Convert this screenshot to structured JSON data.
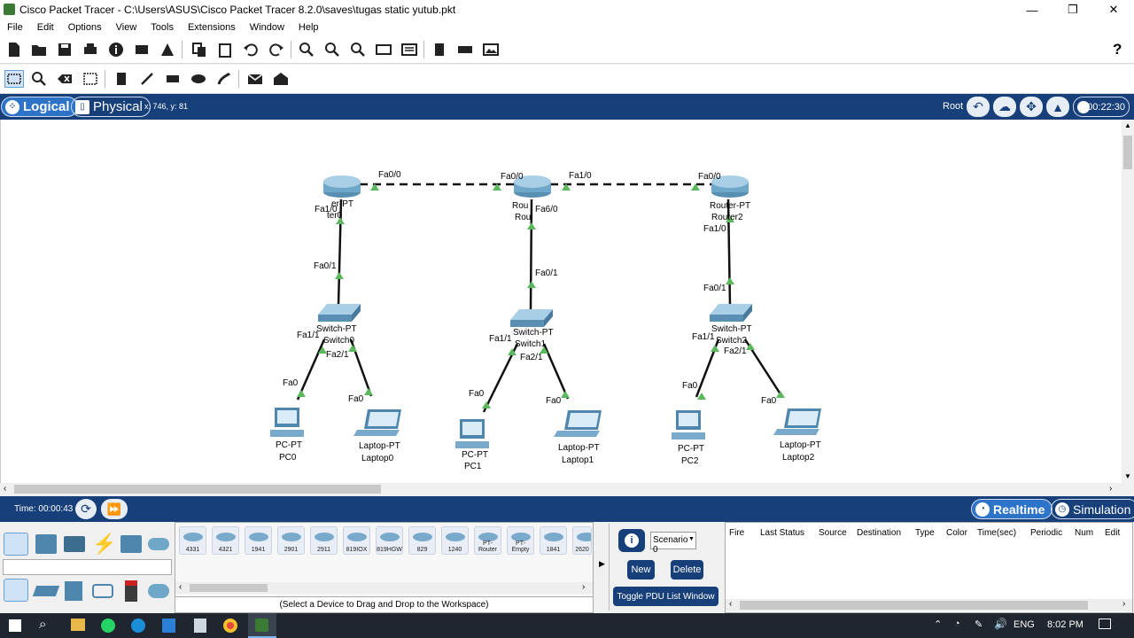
{
  "window": {
    "title": "Cisco Packet Tracer - C:\\Users\\ASUS\\Cisco Packet Tracer 8.2.0\\saves\\tugas static yutub.pkt",
    "controls": [
      "—",
      "❐",
      "✕"
    ]
  },
  "menu": [
    "File",
    "Edit",
    "Options",
    "View",
    "Tools",
    "Extensions",
    "Window",
    "Help"
  ],
  "toolbar1": {
    "help_label": "?"
  },
  "views": {
    "logical": "Logical",
    "physical": "Physical",
    "coords": "x: 746, y: 81",
    "root": "Root",
    "clock": "00:22:30"
  },
  "topology": {
    "devices": [
      {
        "name": "Router0",
        "type": "Router-PT"
      },
      {
        "name": "Router1",
        "type": "Router-PT"
      },
      {
        "name": "Router2",
        "type": "Router-PT"
      },
      {
        "name": "Switch0",
        "type": "Switch-PT"
      },
      {
        "name": "Switch1",
        "type": "Switch-PT"
      },
      {
        "name": "Switch2",
        "type": "Switch-PT"
      },
      {
        "name": "PC0",
        "type": "PC-PT"
      },
      {
        "name": "PC1",
        "type": "PC-PT"
      },
      {
        "name": "PC2",
        "type": "PC-PT"
      },
      {
        "name": "Laptop0",
        "type": "Laptop-PT"
      },
      {
        "name": "Laptop1",
        "type": "Laptop-PT"
      },
      {
        "name": "Laptop2",
        "type": "Laptop-PT"
      }
    ],
    "labels": {
      "r0_r1_a": "Fa0/0",
      "r1_r0": "Fa0/0",
      "r1_r2": "Fa1/0",
      "r2_r1": "Fa0/0",
      "r0_down": "Fa1/0",
      "r1_down": "Fa6/0",
      "r2_down": "Fa1/0",
      "s0_up": "Fa0/1",
      "s1_up": "Fa0/1",
      "s2_up": "Fa0/1",
      "s0_a": "Fa1/1",
      "s0_b": "Fa2/1",
      "s1_a": "Fa1/1",
      "s1_b": "Fa2/1",
      "s2_a": "Fa1/1",
      "s2_b": "Fa2/1",
      "fa0": "Fa0",
      "router_type": "Router-PT",
      "switch_type": "Switch-PT",
      "pc_type": "PC-PT",
      "laptop_type": "Laptop-PT",
      "r0": "Router0",
      "r1": "Router1",
      "r2": "Router2",
      "sw0": "Switch0",
      "sw1": "Switch1",
      "sw2": "Switch2",
      "pc0": "PC0",
      "pc1": "PC1",
      "pc2": "PC2",
      "lap0": "Laptop0",
      "lap1": "Laptop1",
      "lap2": "Laptop2",
      "r1_short": "Rou",
      "router_cut": "er-PT",
      "router0_cut": "ter0"
    }
  },
  "status": {
    "time": "Time: 00:00:43",
    "realtime": "Realtime",
    "simulation": "Simulation"
  },
  "devices_panel": {
    "models": [
      "4331",
      "4321",
      "1941",
      "2901",
      "2911",
      "819IOX",
      "819HGW",
      "829",
      "1240",
      "PT-Router",
      "PT-Empty",
      "1841",
      "2620"
    ],
    "hint": "(Select a Device to Drag and Drop to the Workspace)"
  },
  "scenario": {
    "select": "Scenario 0",
    "new": "New",
    "delete": "Delete",
    "toggle": "Toggle PDU List Window",
    "info": "i"
  },
  "pdu_table": {
    "columns": [
      "Fire",
      "Last Status",
      "Source",
      "Destination",
      "Type",
      "Color",
      "Time(sec)",
      "Periodic",
      "Num",
      "Edit"
    ]
  },
  "taskbar": {
    "lang": "ENG",
    "time": "8:02 PM"
  }
}
